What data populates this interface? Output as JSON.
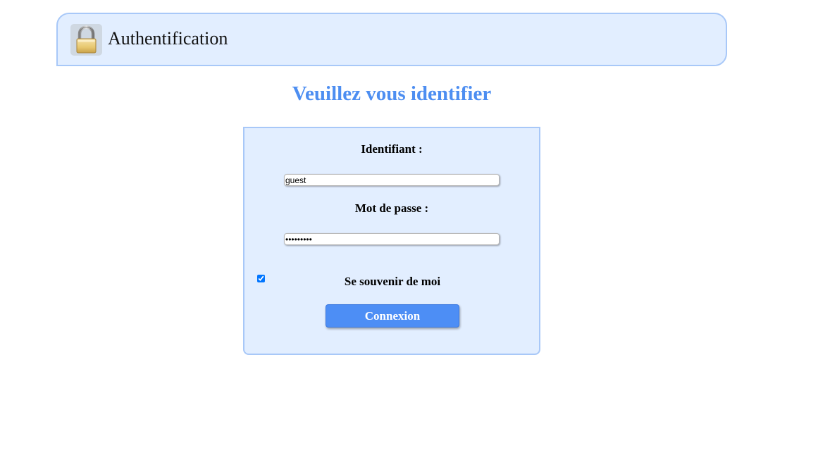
{
  "header": {
    "title": "Authentification",
    "icon": "padlock-icon"
  },
  "page": {
    "title": "Veuillez vous identifier"
  },
  "form": {
    "username_label": "Identifiant :",
    "username_value": "guest",
    "password_label": "Mot de passe :",
    "password_value": "•••••••••",
    "remember_label": "Se souvenir de moi",
    "remember_checked": true,
    "submit_label": "Connexion"
  },
  "colors": {
    "accent": "#4d8ef1",
    "panel_bg": "#e2eeff",
    "panel_border": "#a8c8f8"
  }
}
